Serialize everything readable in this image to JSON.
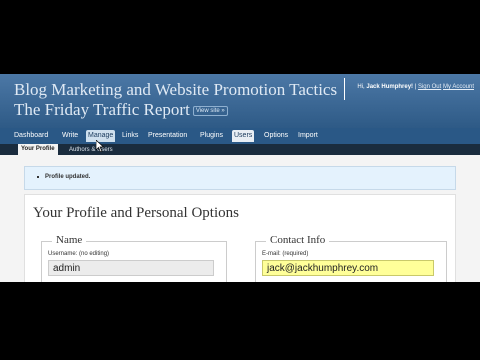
{
  "header": {
    "title_line1": "Blog Marketing and Website Promotion Tactics",
    "title_line2": "The Friday Traffic Report",
    "view_site": "View site »",
    "user_prefix": "Hi,",
    "user_name": "Jack Humphrey!",
    "sign_out": "Sign Out",
    "my_account": "My Account"
  },
  "menu": {
    "items": [
      "Dashboard",
      "Write",
      "Manage",
      "Links",
      "Presentation",
      "Plugins",
      "Users",
      "Options",
      "Import"
    ]
  },
  "submenu": {
    "items": [
      "Your Profile",
      "Authors & Users"
    ]
  },
  "notice": {
    "text": "Profile updated."
  },
  "profile": {
    "title": "Your Profile and Personal Options",
    "name_legend": "Name",
    "username_label": "Username: (no editing)",
    "username_value": "admin",
    "contact_legend": "Contact Info",
    "email_label": "E-mail: (required)",
    "email_value": "jack@jackhumphrey.com"
  },
  "colors": {
    "header": "#3a6794",
    "menu": "#2a5886",
    "submenu": "#1a2c3e",
    "notice_bg": "#e4f2fd",
    "email_highlight": "#ffff99"
  }
}
